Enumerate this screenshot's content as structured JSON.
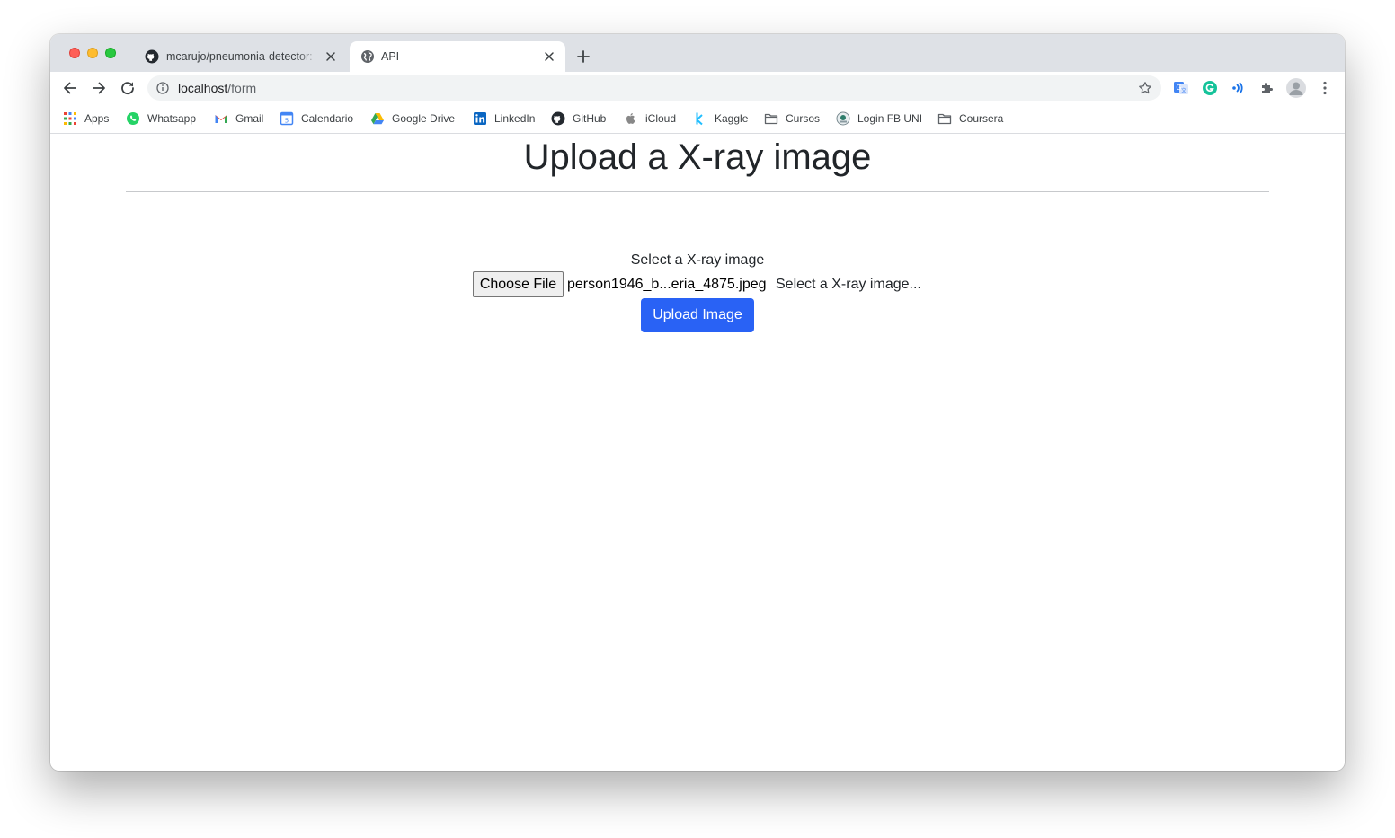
{
  "browser": {
    "tabs": [
      {
        "title": "mcarujo/pneumonia-detector: ",
        "icon": "github-icon",
        "active": false
      },
      {
        "title": "API",
        "icon": "globe-icon",
        "active": true
      }
    ],
    "url_host": "localhost",
    "url_path": "/form",
    "bookmarks": [
      {
        "label": "Apps",
        "icon": "apps-grid-icon"
      },
      {
        "label": "Whatsapp",
        "icon": "whatsapp-icon"
      },
      {
        "label": "Gmail",
        "icon": "gmail-icon"
      },
      {
        "label": "Calendario",
        "icon": "calendar-icon"
      },
      {
        "label": "Google Drive",
        "icon": "google-drive-icon"
      },
      {
        "label": "LinkedIn",
        "icon": "linkedin-icon"
      },
      {
        "label": "GitHub",
        "icon": "github-icon"
      },
      {
        "label": "iCloud",
        "icon": "apple-icon"
      },
      {
        "label": "Kaggle",
        "icon": "kaggle-icon"
      },
      {
        "label": "Cursos",
        "icon": "folder-icon"
      },
      {
        "label": "Login FB UNI",
        "icon": "uni-logo-icon"
      },
      {
        "label": "Coursera",
        "icon": "folder-icon"
      }
    ]
  },
  "page": {
    "title": "Upload a X-ray image",
    "form_label": "Select a X-ray image",
    "choose_file_label": "Choose File",
    "selected_file": "person1946_b...eria_4875.jpeg",
    "placeholder_text": "Select a X-ray image...",
    "upload_button": "Upload Image"
  },
  "colors": {
    "primary_button": "#2962f5",
    "tabstrip": "#dee1e6",
    "heading_text": "#212529"
  }
}
